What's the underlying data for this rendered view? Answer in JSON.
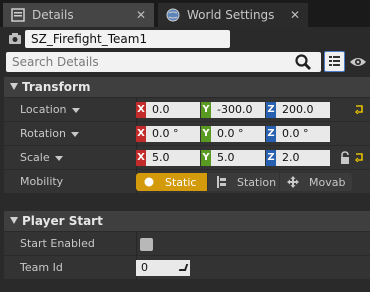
{
  "tabs": [
    {
      "label": "Details",
      "icon": "details-icon",
      "active": true
    },
    {
      "label": "World Settings",
      "icon": "globe-icon",
      "active": false
    }
  ],
  "actor": {
    "name": "SZ_Firefight_Team1"
  },
  "search": {
    "placeholder": "Search Details"
  },
  "categories": {
    "transform": {
      "title": "Transform",
      "location": {
        "label": "Location",
        "x": "0.0",
        "y": "-300.0",
        "z": "200.0"
      },
      "rotation": {
        "label": "Rotation",
        "x": "0.0 °",
        "y": "0.0 °",
        "z": "0.0 °"
      },
      "scale": {
        "label": "Scale",
        "x": "5.0",
        "y": "5.0",
        "z": "2.0"
      },
      "mobility": {
        "label": "Mobility",
        "options": [
          "Static",
          "Station",
          "Movab"
        ],
        "selected": "Static"
      }
    },
    "player_start": {
      "title": "Player Start",
      "start_enabled": {
        "label": "Start Enabled",
        "checked": false
      },
      "team_id": {
        "label": "Team Id",
        "value": "0"
      }
    }
  },
  "axis_letters": {
    "x": "X",
    "y": "Y",
    "z": "Z"
  },
  "colors": {
    "x_axis": "#c32a2a",
    "y_axis": "#5b9a22",
    "z_axis": "#2860b0",
    "static_active": "#d39b0b",
    "reset_arrow": "#e5c000"
  }
}
